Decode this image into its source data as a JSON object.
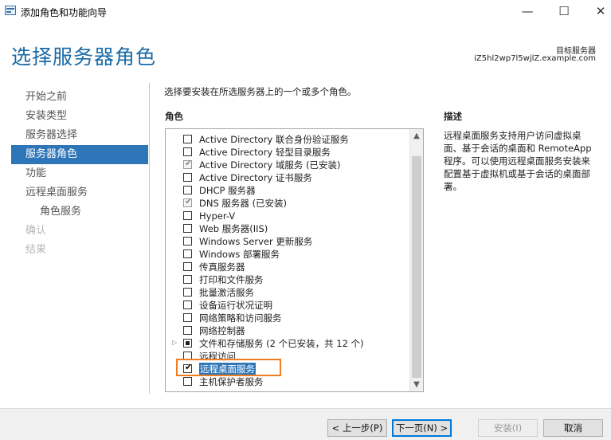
{
  "window": {
    "title": "添加角色和功能向导",
    "controls": {
      "minimize": "—",
      "maximize": "☐",
      "close": "✕"
    }
  },
  "header": {
    "page_title": "选择服务器角色",
    "destination_label": "目标服务器",
    "destination_value": "iZ5hl2wp7l5wjlZ.example.com"
  },
  "nav": {
    "items": [
      {
        "label": "开始之前",
        "state": "normal"
      },
      {
        "label": "安装类型",
        "state": "normal"
      },
      {
        "label": "服务器选择",
        "state": "normal"
      },
      {
        "label": "服务器角色",
        "state": "active"
      },
      {
        "label": "功能",
        "state": "normal"
      },
      {
        "label": "远程桌面服务",
        "state": "normal"
      },
      {
        "label": "角色服务",
        "state": "sub"
      },
      {
        "label": "确认",
        "state": "disabled"
      },
      {
        "label": "结果",
        "state": "disabled"
      }
    ]
  },
  "main": {
    "instruction": "选择要安装在所选服务器上的一个或多个角色。",
    "roles_heading": "角色",
    "roles": [
      {
        "label": "Active Directory 联合身份验证服务",
        "state": "unchecked"
      },
      {
        "label": "Active Directory 轻型目录服务",
        "state": "unchecked"
      },
      {
        "label": "Active Directory 域服务 (已安装)",
        "state": "installed"
      },
      {
        "label": "Active Directory 证书服务",
        "state": "unchecked"
      },
      {
        "label": "DHCP 服务器",
        "state": "unchecked"
      },
      {
        "label": "DNS 服务器 (已安装)",
        "state": "installed"
      },
      {
        "label": "Hyper-V",
        "state": "unchecked"
      },
      {
        "label": "Web 服务器(IIS)",
        "state": "unchecked"
      },
      {
        "label": "Windows Server 更新服务",
        "state": "unchecked"
      },
      {
        "label": "Windows 部署服务",
        "state": "unchecked"
      },
      {
        "label": "传真服务器",
        "state": "unchecked"
      },
      {
        "label": "打印和文件服务",
        "state": "unchecked"
      },
      {
        "label": "批量激活服务",
        "state": "unchecked"
      },
      {
        "label": "设备运行状况证明",
        "state": "unchecked"
      },
      {
        "label": "网络策略和访问服务",
        "state": "unchecked"
      },
      {
        "label": "网络控制器",
        "state": "unchecked"
      },
      {
        "label": "文件和存储服务 (2 个已安装，共 12 个)",
        "state": "partial",
        "expandable": true
      },
      {
        "label": "远程访问",
        "state": "unchecked"
      },
      {
        "label": "远程桌面服务",
        "state": "checked",
        "selected": true
      },
      {
        "label": "主机保护者服务",
        "state": "unchecked"
      }
    ],
    "description_heading": "描述",
    "description_text": "远程桌面服务支持用户访问虚拟桌面、基于会话的桌面和 RemoteApp 程序。可以使用远程桌面服务安装来配置基于虚拟机或基于会话的桌面部署。"
  },
  "footer": {
    "prev": "< 上一步(P)",
    "next": "下一页(N) >",
    "install": "安装(I)",
    "cancel": "取消"
  },
  "colors": {
    "accent": "#2f76b8",
    "title_blue": "#1a6aa6",
    "highlight": "#ef7d22"
  }
}
